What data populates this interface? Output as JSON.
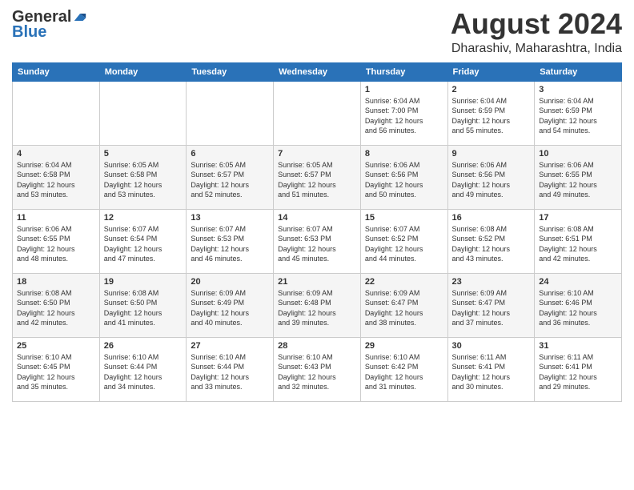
{
  "logo": {
    "line1": "General",
    "line2": "Blue"
  },
  "title": "August 2024",
  "subtitle": "Dharashiv, Maharashtra, India",
  "days_of_week": [
    "Sunday",
    "Monday",
    "Tuesday",
    "Wednesday",
    "Thursday",
    "Friday",
    "Saturday"
  ],
  "weeks": [
    [
      {
        "day": "",
        "info": ""
      },
      {
        "day": "",
        "info": ""
      },
      {
        "day": "",
        "info": ""
      },
      {
        "day": "",
        "info": ""
      },
      {
        "day": "1",
        "info": "Sunrise: 6:04 AM\nSunset: 7:00 PM\nDaylight: 12 hours\nand 56 minutes."
      },
      {
        "day": "2",
        "info": "Sunrise: 6:04 AM\nSunset: 6:59 PM\nDaylight: 12 hours\nand 55 minutes."
      },
      {
        "day": "3",
        "info": "Sunrise: 6:04 AM\nSunset: 6:59 PM\nDaylight: 12 hours\nand 54 minutes."
      }
    ],
    [
      {
        "day": "4",
        "info": "Sunrise: 6:04 AM\nSunset: 6:58 PM\nDaylight: 12 hours\nand 53 minutes."
      },
      {
        "day": "5",
        "info": "Sunrise: 6:05 AM\nSunset: 6:58 PM\nDaylight: 12 hours\nand 53 minutes."
      },
      {
        "day": "6",
        "info": "Sunrise: 6:05 AM\nSunset: 6:57 PM\nDaylight: 12 hours\nand 52 minutes."
      },
      {
        "day": "7",
        "info": "Sunrise: 6:05 AM\nSunset: 6:57 PM\nDaylight: 12 hours\nand 51 minutes."
      },
      {
        "day": "8",
        "info": "Sunrise: 6:06 AM\nSunset: 6:56 PM\nDaylight: 12 hours\nand 50 minutes."
      },
      {
        "day": "9",
        "info": "Sunrise: 6:06 AM\nSunset: 6:56 PM\nDaylight: 12 hours\nand 49 minutes."
      },
      {
        "day": "10",
        "info": "Sunrise: 6:06 AM\nSunset: 6:55 PM\nDaylight: 12 hours\nand 49 minutes."
      }
    ],
    [
      {
        "day": "11",
        "info": "Sunrise: 6:06 AM\nSunset: 6:55 PM\nDaylight: 12 hours\nand 48 minutes."
      },
      {
        "day": "12",
        "info": "Sunrise: 6:07 AM\nSunset: 6:54 PM\nDaylight: 12 hours\nand 47 minutes."
      },
      {
        "day": "13",
        "info": "Sunrise: 6:07 AM\nSunset: 6:53 PM\nDaylight: 12 hours\nand 46 minutes."
      },
      {
        "day": "14",
        "info": "Sunrise: 6:07 AM\nSunset: 6:53 PM\nDaylight: 12 hours\nand 45 minutes."
      },
      {
        "day": "15",
        "info": "Sunrise: 6:07 AM\nSunset: 6:52 PM\nDaylight: 12 hours\nand 44 minutes."
      },
      {
        "day": "16",
        "info": "Sunrise: 6:08 AM\nSunset: 6:52 PM\nDaylight: 12 hours\nand 43 minutes."
      },
      {
        "day": "17",
        "info": "Sunrise: 6:08 AM\nSunset: 6:51 PM\nDaylight: 12 hours\nand 42 minutes."
      }
    ],
    [
      {
        "day": "18",
        "info": "Sunrise: 6:08 AM\nSunset: 6:50 PM\nDaylight: 12 hours\nand 42 minutes."
      },
      {
        "day": "19",
        "info": "Sunrise: 6:08 AM\nSunset: 6:50 PM\nDaylight: 12 hours\nand 41 minutes."
      },
      {
        "day": "20",
        "info": "Sunrise: 6:09 AM\nSunset: 6:49 PM\nDaylight: 12 hours\nand 40 minutes."
      },
      {
        "day": "21",
        "info": "Sunrise: 6:09 AM\nSunset: 6:48 PM\nDaylight: 12 hours\nand 39 minutes."
      },
      {
        "day": "22",
        "info": "Sunrise: 6:09 AM\nSunset: 6:47 PM\nDaylight: 12 hours\nand 38 minutes."
      },
      {
        "day": "23",
        "info": "Sunrise: 6:09 AM\nSunset: 6:47 PM\nDaylight: 12 hours\nand 37 minutes."
      },
      {
        "day": "24",
        "info": "Sunrise: 6:10 AM\nSunset: 6:46 PM\nDaylight: 12 hours\nand 36 minutes."
      }
    ],
    [
      {
        "day": "25",
        "info": "Sunrise: 6:10 AM\nSunset: 6:45 PM\nDaylight: 12 hours\nand 35 minutes."
      },
      {
        "day": "26",
        "info": "Sunrise: 6:10 AM\nSunset: 6:44 PM\nDaylight: 12 hours\nand 34 minutes."
      },
      {
        "day": "27",
        "info": "Sunrise: 6:10 AM\nSunset: 6:44 PM\nDaylight: 12 hours\nand 33 minutes."
      },
      {
        "day": "28",
        "info": "Sunrise: 6:10 AM\nSunset: 6:43 PM\nDaylight: 12 hours\nand 32 minutes."
      },
      {
        "day": "29",
        "info": "Sunrise: 6:10 AM\nSunset: 6:42 PM\nDaylight: 12 hours\nand 31 minutes."
      },
      {
        "day": "30",
        "info": "Sunrise: 6:11 AM\nSunset: 6:41 PM\nDaylight: 12 hours\nand 30 minutes."
      },
      {
        "day": "31",
        "info": "Sunrise: 6:11 AM\nSunset: 6:41 PM\nDaylight: 12 hours\nand 29 minutes."
      }
    ]
  ]
}
